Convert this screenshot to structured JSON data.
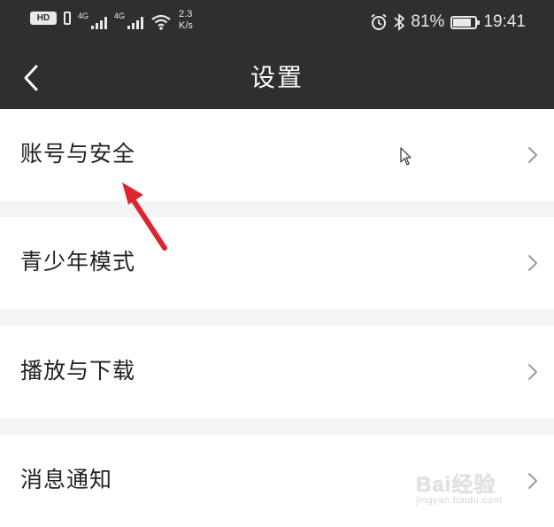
{
  "status_bar": {
    "hd_label": "HD",
    "network_1": "4G",
    "network_2": "4G",
    "speed": "2.3\nK/s",
    "battery_percent": "81%",
    "time": "19:41",
    "icons": [
      "hd-icon",
      "signal-icon",
      "wifi-icon",
      "alarm-icon",
      "bluetooth-icon",
      "battery-icon"
    ]
  },
  "header": {
    "title": "设置",
    "back_icon": "chevron-left-icon"
  },
  "settings": {
    "items": [
      {
        "label": "账号与安全"
      },
      {
        "label": "青少年模式"
      },
      {
        "label": "播放与下载"
      },
      {
        "label": "消息通知"
      }
    ]
  },
  "watermark": {
    "brand": "Bai经验",
    "url": "jingyan.baidu.com"
  },
  "colors": {
    "header_bg": "#2f2f2f",
    "page_bg": "#f4f4f4",
    "annotation_arrow": "#e0242f"
  }
}
